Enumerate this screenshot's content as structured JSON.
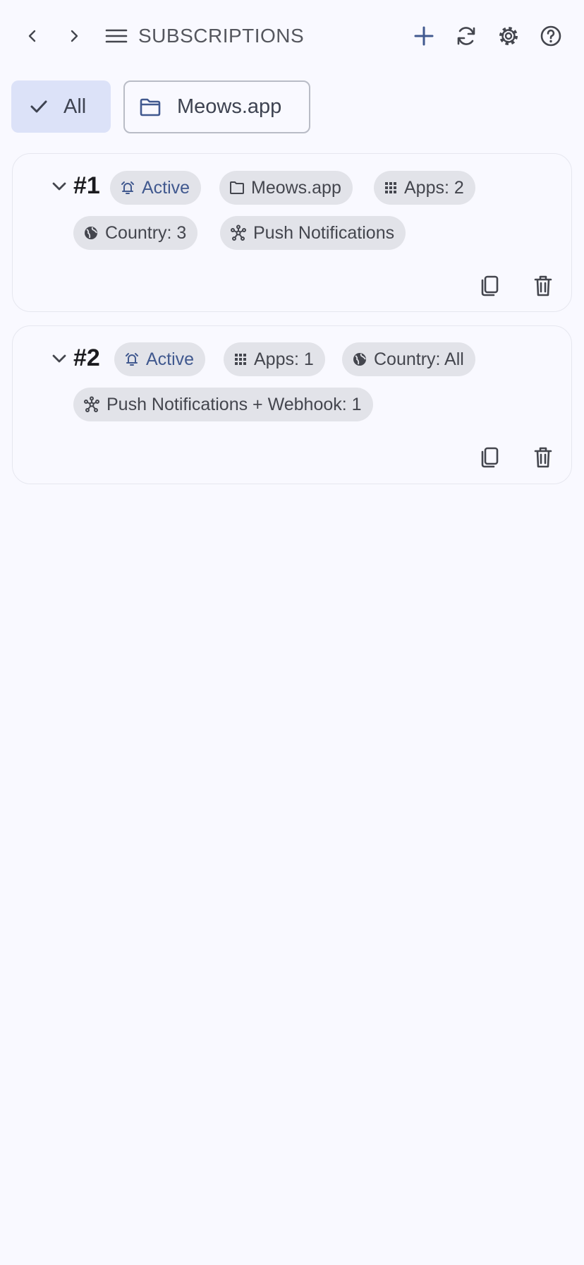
{
  "toolbar": {
    "title": "SUBSCRIPTIONS",
    "icons": [
      "back-icon",
      "forward-icon",
      "menu-icon",
      "add-icon",
      "refresh-icon",
      "settings-icon",
      "help-icon"
    ]
  },
  "filters": {
    "all_label": "All",
    "folder_label": "Meows.app",
    "selected": "All"
  },
  "subscriptions": [
    {
      "number": "#1",
      "status": "Active",
      "folder": "Meows.app",
      "apps": "Apps: 2",
      "country": "Country: 3",
      "channel": "Push Notifications"
    },
    {
      "number": "#2",
      "status": "Active",
      "apps": "Apps: 1",
      "country": "Country: All",
      "channel": "Push Notifications + Webhook: 1"
    }
  ],
  "colors": {
    "background": "#f9f9ff",
    "accent": "#41598f",
    "selected_filter": "#dce2f8",
    "chip": "#e2e3e9"
  }
}
